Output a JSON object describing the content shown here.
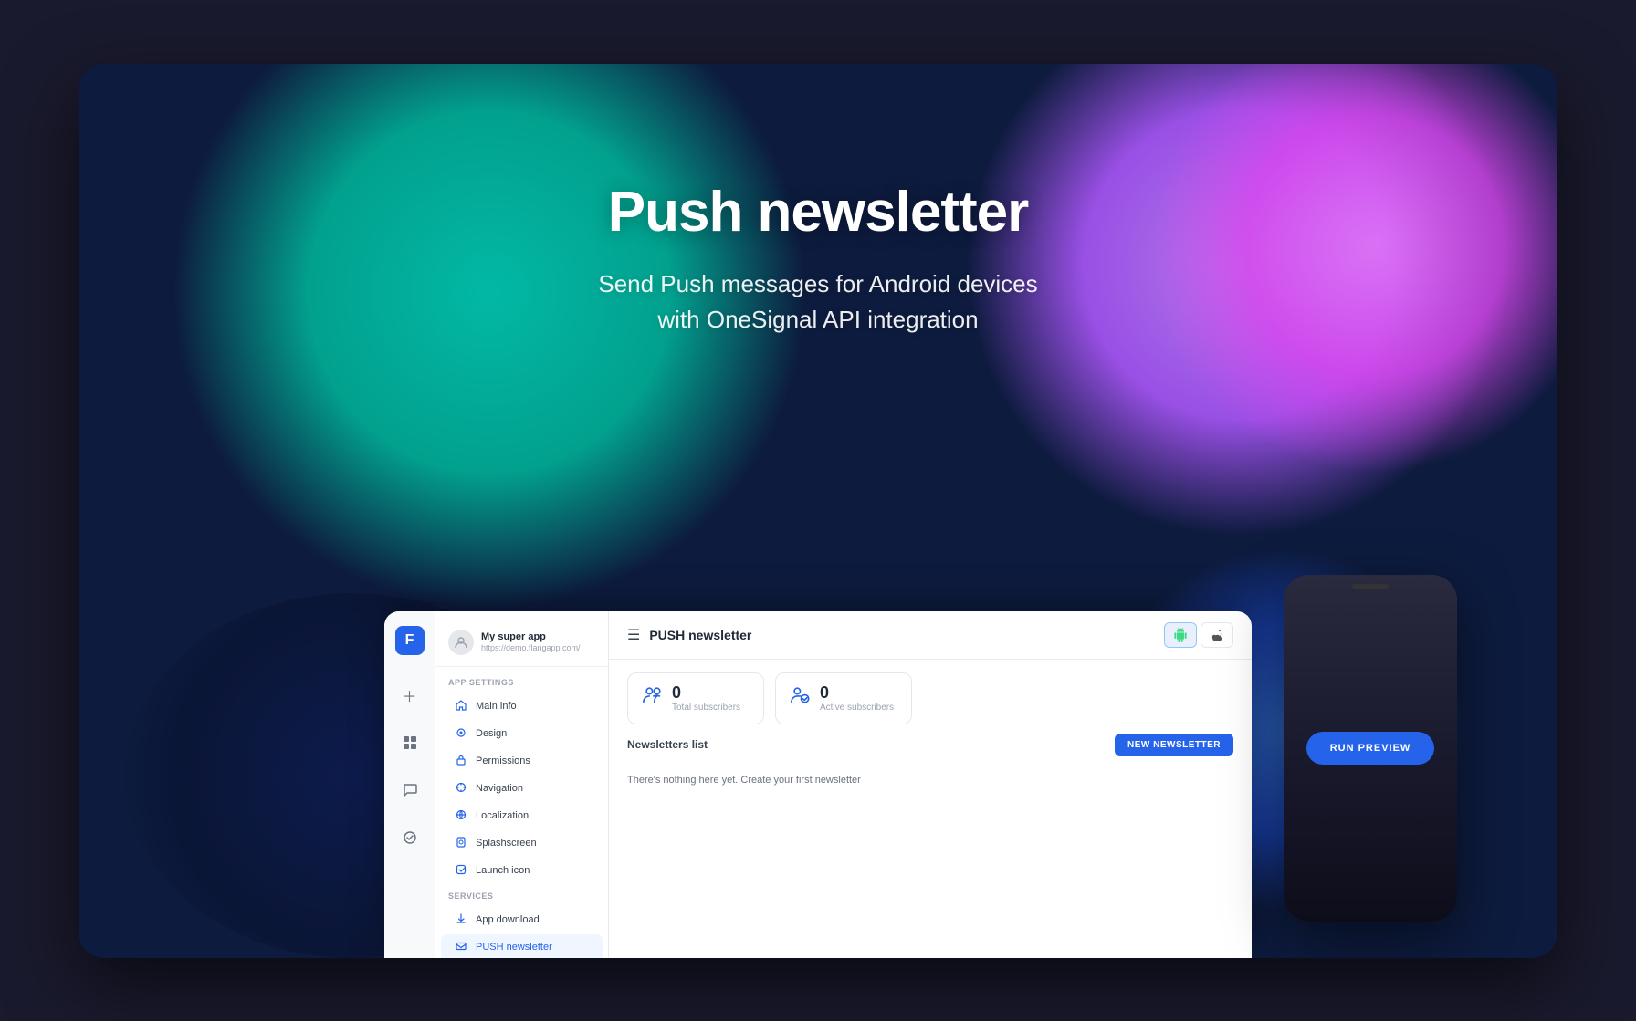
{
  "hero": {
    "title": "Push newsletter",
    "subtitle_line1": "Send Push messages for Android devices",
    "subtitle_line2": "with OneSignal API integration"
  },
  "sidebar_icons": {
    "logo_letter": "F",
    "icons": [
      "+",
      "⊞",
      "💬",
      "⚡"
    ]
  },
  "sidebar_nav": {
    "app_name": "My super app",
    "app_url": "https://demo.flangapp.com/",
    "sections": [
      {
        "label": "App settings",
        "items": [
          {
            "icon": "🏠",
            "label": "Main info",
            "active": false
          },
          {
            "icon": "🎨",
            "label": "Design",
            "active": false
          },
          {
            "icon": "🔒",
            "label": "Permissions",
            "active": false
          },
          {
            "icon": "🧭",
            "label": "Navigation",
            "active": false
          },
          {
            "icon": "🌐",
            "label": "Localization",
            "active": false
          },
          {
            "icon": "📱",
            "label": "Splashscreen",
            "active": false
          },
          {
            "icon": "🚀",
            "label": "Launch icon",
            "active": false
          }
        ]
      },
      {
        "label": "Services",
        "items": [
          {
            "icon": "⬇️",
            "label": "App download",
            "active": false
          },
          {
            "icon": "📩",
            "label": "PUSH newsletter",
            "active": true
          }
        ]
      }
    ]
  },
  "topbar": {
    "menu_icon": "☰",
    "title": "PUSH newsletter",
    "platform_android_icon": "🤖",
    "platform_apple_icon": ""
  },
  "stats": [
    {
      "icon": "👥",
      "number": "0",
      "label": "Total subscribers"
    },
    {
      "icon": "👥",
      "number": "0",
      "label": "Active subscribers"
    }
  ],
  "newsletters": {
    "section_title": "Newsletters list",
    "new_button_label": "NEW NEWSLETTER",
    "empty_message": "There's nothing here yet. Create your first newsletter"
  },
  "phone": {
    "run_preview_label": "RUN PREVIEW"
  }
}
